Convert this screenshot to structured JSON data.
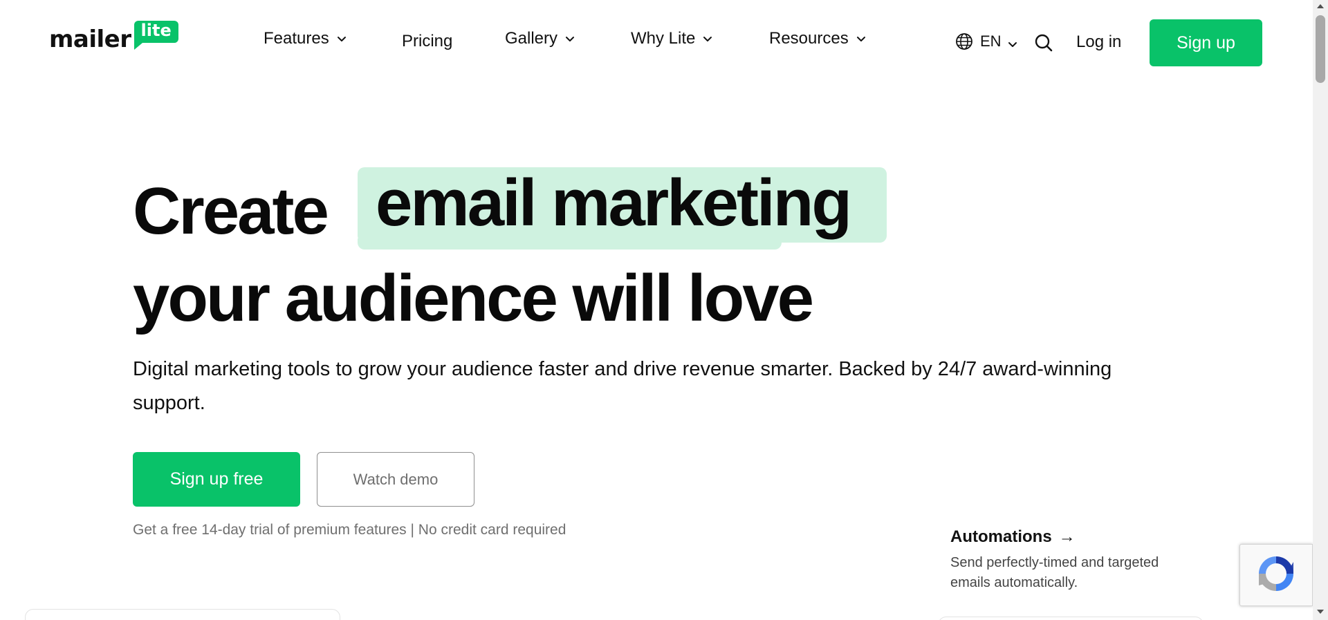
{
  "header": {
    "logo": {
      "word": "mailer",
      "badge": "lite"
    },
    "nav": [
      {
        "label": "Features",
        "has_dropdown": true
      },
      {
        "label": "Pricing",
        "has_dropdown": false
      },
      {
        "label": "Gallery",
        "has_dropdown": true
      },
      {
        "label": "Why Lite",
        "has_dropdown": true
      },
      {
        "label": "Resources",
        "has_dropdown": true
      }
    ],
    "language": "EN",
    "login_label": "Log in",
    "signup_label": "Sign up"
  },
  "hero": {
    "headline_part1": "Create",
    "headline_highlight": "email marketing",
    "headline_line2": "your audience will love",
    "subtitle": "Digital marketing tools to grow your audience faster and drive revenue smarter. Backed by 24/7 award-winning support.",
    "primary_button": "Sign up free",
    "secondary_button": "Watch demo",
    "note": "Get a free 14-day trial of premium features | No credit card required"
  },
  "feature_teaser": {
    "title": "Automations",
    "arrow": "→",
    "description": "Send perfectly-timed and targeted emails automatically."
  },
  "colors": {
    "brand_green": "#09c269",
    "highlight": "#cff2e0"
  }
}
